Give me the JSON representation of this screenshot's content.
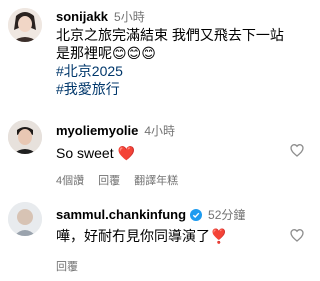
{
  "comments": [
    {
      "handle": "sonijakk",
      "time": "5小時",
      "text_lines": [
        "北京之旅完滿結束 我們又飛去下一站",
        "是那裡呢😊😊😊"
      ],
      "hashtags": [
        "#北京2025",
        "#我愛旅行"
      ]
    },
    {
      "handle": "myoliemyolie",
      "time": "4小時",
      "text": "So sweet ❤️",
      "likes": "4個讚",
      "reply": "回覆",
      "translate": "翻譯年糕",
      "like_icon": "heart-outline-icon"
    },
    {
      "handle": "sammul.chankinfung",
      "verified_icon": "verified-badge-icon",
      "time": "52分鐘",
      "text": "嘩，好耐冇見你同導演了❣️",
      "reply": "回覆",
      "like_icon": "heart-outline-icon"
    }
  ],
  "colors": {
    "verified": "#1d9bf0",
    "hashtag": "#00376b",
    "meta": "#737373",
    "heart_red": "#e0001b"
  }
}
